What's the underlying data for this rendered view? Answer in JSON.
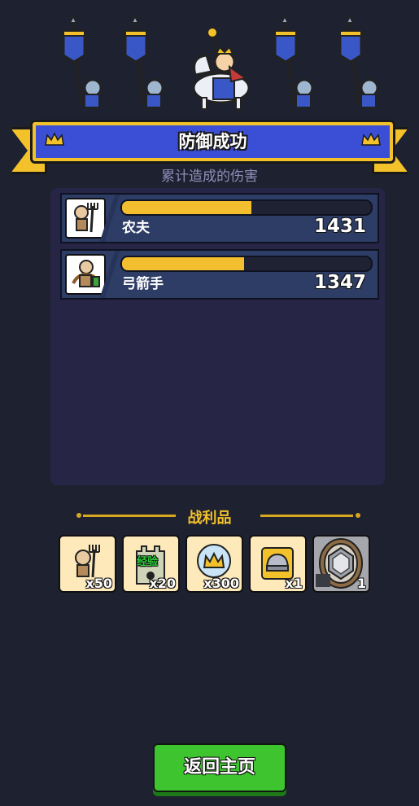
{
  "banner": {
    "title": "防御成功"
  },
  "damage": {
    "subtitle": "累计造成的伤害",
    "units": [
      {
        "name": "农夫",
        "value": "1431",
        "bar_fraction": 0.52,
        "icon": "farmer-icon"
      },
      {
        "name": "弓箭手",
        "value": "1347",
        "bar_fraction": 0.49,
        "icon": "archer-icon"
      }
    ]
  },
  "loot": {
    "title": "战利品",
    "items": [
      {
        "icon": "farmer-pitchfork-icon",
        "count": "x50"
      },
      {
        "icon": "tower-icon",
        "label": "经验",
        "count": "x20"
      },
      {
        "icon": "crown-coin-icon",
        "count": "x300"
      },
      {
        "icon": "viking-helmet-icon",
        "count": "x1"
      },
      {
        "icon": "gray-gem-shield-icon",
        "count": "1"
      }
    ]
  },
  "button": {
    "home": "返回主页"
  },
  "colors": {
    "accent": "#f3c22a",
    "ribbon": "#3a4fd6",
    "button": "#3ec42f",
    "bg": "#1e2130"
  }
}
